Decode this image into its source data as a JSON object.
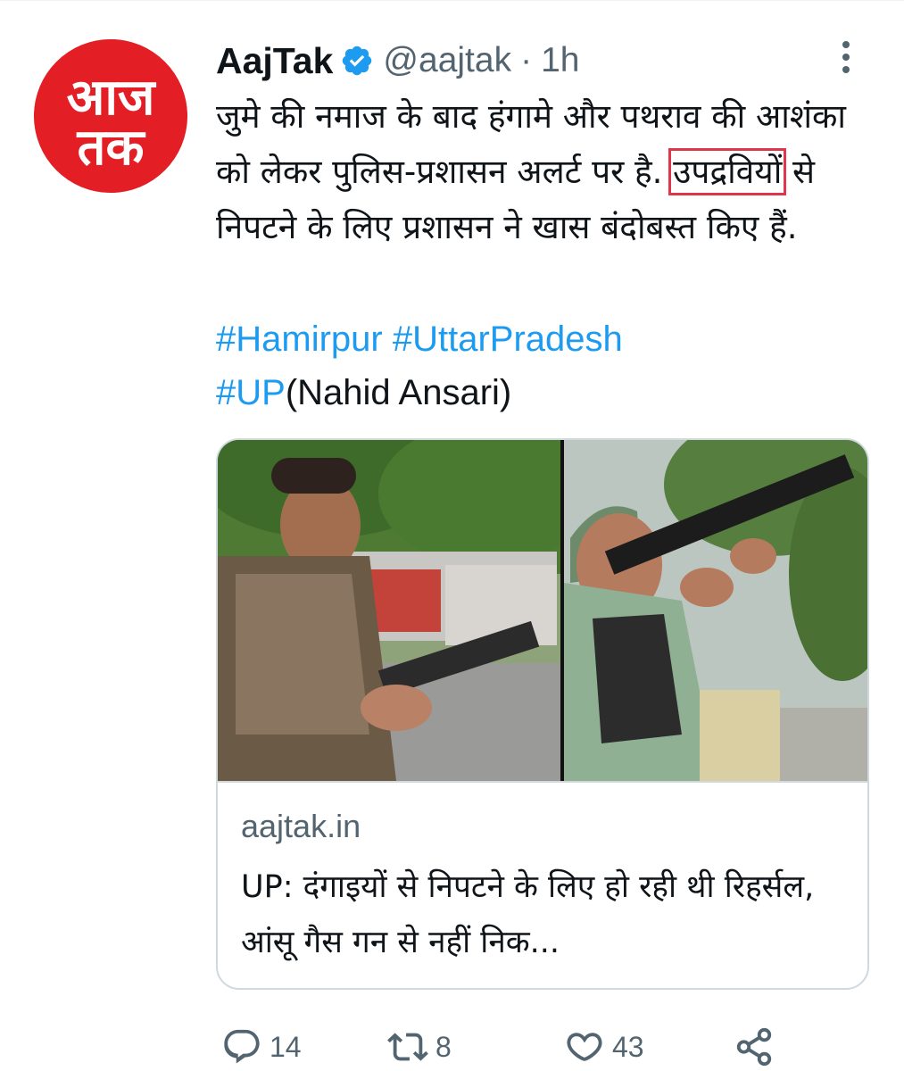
{
  "tweet": {
    "author_name": "AajTak",
    "handle": "@aajtak",
    "separator": "·",
    "time": "1h",
    "avatar_text_top": "आज",
    "avatar_text_bottom": "तक",
    "text_part1": "जुमे की नमाज के बाद हंगामे और पथराव की आशंका को लेकर पुलिस-प्रशासन अलर्ट पर है. ",
    "text_highlight": "उपद्रवियों",
    "text_part2": " से निपटने के लिए प्रशासन ने खास बंदोबस्त किए हैं.",
    "hashtags": [
      "#Hamirpur",
      "#UttarPradesh",
      "#UP"
    ],
    "credit": "(Nahid Ansari)"
  },
  "card": {
    "domain": "aajtak.in",
    "title": "UP: दंगाइयों से निपटने के लिए हो रही थी रिहर्सल, आंसू गैस गन से नहीं निक..."
  },
  "actions": {
    "replies": "14",
    "retweets": "8",
    "likes": "43"
  },
  "colors": {
    "brand_red": "#e31e24",
    "link_blue": "#1d9bf0",
    "highlight_box": "#e0364c",
    "muted": "#536471"
  }
}
